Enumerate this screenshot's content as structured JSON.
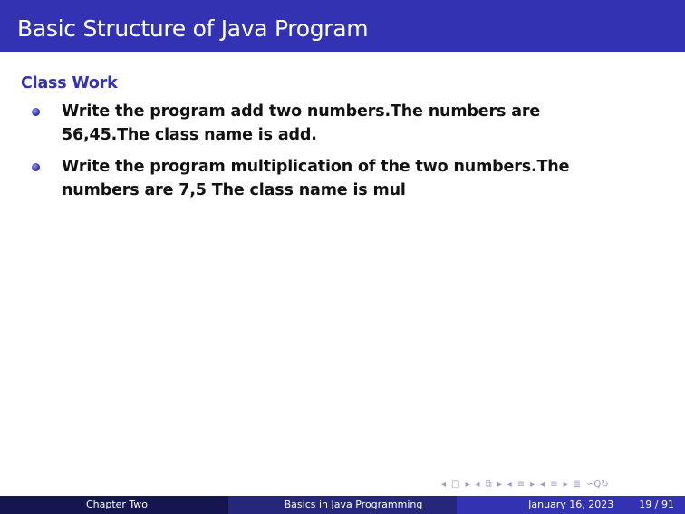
{
  "header": {
    "title": "Basic Structure of Java Program"
  },
  "block": {
    "title": "Class Work",
    "items": [
      {
        "line1": "Write the program add two numbers.The numbers are",
        "line2": "56,45.The class name is add."
      },
      {
        "line1": "Write the program multiplication of the two numbers.The",
        "line2": "numbers are 7,5 The class name is mul"
      }
    ]
  },
  "nav": {
    "icons": [
      "left-arrow-icon",
      "frame-icon",
      "right-arrow-icon",
      "left-arrow-icon",
      "subsection-icon",
      "right-arrow-icon",
      "left-arrow-icon",
      "section-icon",
      "right-arrow-icon",
      "left-arrow-icon",
      "list-icon",
      "right-arrow-icon",
      "align-icon",
      "search-icon"
    ]
  },
  "footer": {
    "author": "Chapter Two",
    "title": "Basics in Java Programming",
    "date": "January 16, 2023",
    "page": "19 / 91"
  },
  "colors": {
    "title_bar": "#3232b3",
    "block_title": "#3232b3",
    "footer_left": "#15154f",
    "footer_mid": "#26267a",
    "footer_right": "#3232b3"
  }
}
